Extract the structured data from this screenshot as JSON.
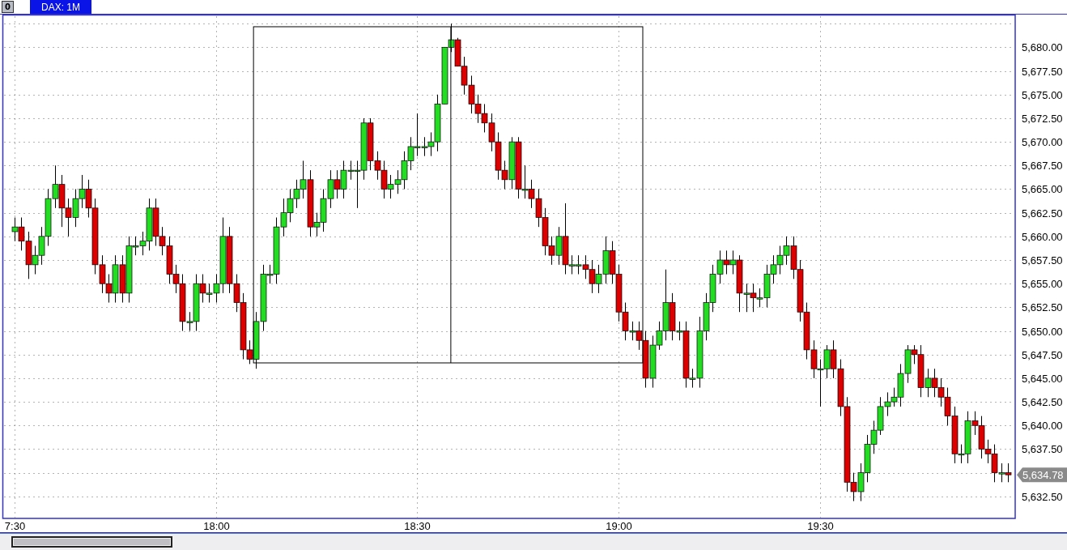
{
  "window": {
    "button": "0"
  },
  "chart": {
    "last_price_label": "5,634.78",
    "chart_data": {
      "type": "candlestick",
      "title": "DAX: 1M",
      "grid": true,
      "ylim": [
        5630.17,
        5683.42
      ],
      "yticks": [
        {
          "value": 5632.5,
          "label": "5,632.50"
        },
        {
          "value": 5637.5,
          "label": "5,637.50"
        },
        {
          "value": 5640,
          "label": "5,640.00"
        },
        {
          "value": 5642.5,
          "label": "5,642.50"
        },
        {
          "value": 5645,
          "label": "5,645.00"
        },
        {
          "value": 5647.5,
          "label": "5,647.50"
        },
        {
          "value": 5650,
          "label": "5,650.00"
        },
        {
          "value": 5652.5,
          "label": "5,652.50"
        },
        {
          "value": 5655,
          "label": "5,655.00"
        },
        {
          "value": 5657.5,
          "label": "5,657.50"
        },
        {
          "value": 5660,
          "label": "5,660.00"
        },
        {
          "value": 5662.5,
          "label": "5,662.50"
        },
        {
          "value": 5665,
          "label": "5,665.00"
        },
        {
          "value": 5667.5,
          "label": "5,667.50"
        },
        {
          "value": 5670,
          "label": "5,670.00"
        },
        {
          "value": 5672.5,
          "label": "5,672.50"
        },
        {
          "value": 5675,
          "label": "5,675.00"
        },
        {
          "value": 5677.5,
          "label": "5,677.50"
        },
        {
          "value": 5680,
          "label": "5,680.00"
        }
      ],
      "categories": [
        "7:30",
        null,
        null,
        null,
        null,
        null,
        null,
        null,
        null,
        null,
        null,
        null,
        null,
        null,
        null,
        null,
        null,
        null,
        null,
        null,
        null,
        null,
        null,
        null,
        null,
        null,
        null,
        null,
        null,
        null,
        "18:00",
        null,
        null,
        null,
        null,
        null,
        null,
        null,
        null,
        null,
        null,
        null,
        null,
        null,
        null,
        null,
        null,
        null,
        null,
        null,
        null,
        null,
        null,
        null,
        null,
        null,
        null,
        null,
        null,
        null,
        "18:30",
        null,
        null,
        null,
        null,
        null,
        null,
        null,
        null,
        null,
        null,
        null,
        null,
        null,
        null,
        null,
        null,
        null,
        null,
        null,
        null,
        null,
        null,
        null,
        null,
        null,
        null,
        null,
        null,
        null,
        "19:00",
        null,
        null,
        null,
        null,
        null,
        null,
        null,
        null,
        null,
        null,
        null,
        null,
        null,
        null,
        null,
        null,
        null,
        null,
        null,
        null,
        null,
        null,
        null,
        null,
        null,
        null,
        null,
        null,
        null,
        "19:30",
        null,
        null,
        null,
        null,
        null,
        null,
        null,
        null,
        null,
        null,
        null,
        null,
        null,
        null,
        null,
        null,
        null,
        null,
        null,
        null,
        null,
        null,
        null,
        null,
        null,
        null,
        null,
        null
      ],
      "ohlc": [
        [
          5660.5,
          5662,
          5659.5,
          5661
        ],
        [
          5661,
          5662,
          5658.5,
          5659.5
        ],
        [
          5659.5,
          5660.5,
          5655.5,
          5657
        ],
        [
          5657,
          5659,
          5656,
          5658
        ],
        [
          5658,
          5661,
          5657,
          5660
        ],
        [
          5660,
          5665,
          5659,
          5664
        ],
        [
          5664,
          5667.5,
          5663,
          5665.5
        ],
        [
          5665.5,
          5666.5,
          5661,
          5663
        ],
        [
          5663,
          5664,
          5660,
          5662
        ],
        [
          5662,
          5665,
          5661,
          5664
        ],
        [
          5664,
          5666.5,
          5663,
          5665
        ],
        [
          5665,
          5666,
          5662,
          5663
        ],
        [
          5663,
          5664,
          5656,
          5657
        ],
        [
          5657,
          5658,
          5654,
          5655
        ],
        [
          5655,
          5656,
          5653,
          5654
        ],
        [
          5654,
          5658,
          5653,
          5657
        ],
        [
          5657,
          5658,
          5653,
          5654
        ],
        [
          5654,
          5660,
          5653,
          5659
        ],
        [
          5659,
          5660,
          5658,
          5659
        ],
        [
          5659,
          5660.5,
          5658,
          5659.5
        ],
        [
          5659.5,
          5664,
          5658.5,
          5663
        ],
        [
          5663,
          5664,
          5659,
          5660
        ],
        [
          5660,
          5661,
          5658,
          5659
        ],
        [
          5659,
          5660,
          5655,
          5656
        ],
        [
          5656,
          5657,
          5654,
          5655
        ],
        [
          5655,
          5656,
          5650,
          5651
        ],
        [
          5651,
          5652,
          5650,
          5651
        ],
        [
          5651,
          5656,
          5650,
          5655
        ],
        [
          5655,
          5656,
          5653,
          5654
        ],
        [
          5654,
          5655,
          5653,
          5654
        ],
        [
          5654,
          5656,
          5653,
          5655
        ],
        [
          5655,
          5662,
          5654,
          5660
        ],
        [
          5660,
          5661,
          5654,
          5655
        ],
        [
          5655,
          5656,
          5652,
          5653
        ],
        [
          5653,
          5654,
          5647,
          5648
        ],
        [
          5648,
          5649,
          5646.5,
          5647
        ],
        [
          5647,
          5652,
          5646,
          5651
        ],
        [
          5651,
          5657,
          5650,
          5656
        ],
        [
          5656,
          5657,
          5655,
          5656
        ],
        [
          5656,
          5662,
          5655,
          5661
        ],
        [
          5661,
          5664,
          5660,
          5662.5
        ],
        [
          5662.5,
          5665,
          5661.5,
          5664
        ],
        [
          5664,
          5666,
          5663,
          5665
        ],
        [
          5665,
          5668,
          5664,
          5666
        ],
        [
          5666,
          5667,
          5660,
          5661
        ],
        [
          5661,
          5662.5,
          5660,
          5661.5
        ],
        [
          5661.5,
          5665,
          5660.5,
          5664
        ],
        [
          5664,
          5667,
          5663,
          5666
        ],
        [
          5666,
          5667,
          5664,
          5665
        ],
        [
          5665,
          5668,
          5664,
          5667
        ],
        [
          5667,
          5668,
          5666,
          5667
        ],
        [
          5667,
          5668,
          5663,
          5667
        ],
        [
          5667,
          5672.5,
          5666,
          5672
        ],
        [
          5672,
          5672.5,
          5667,
          5668
        ],
        [
          5668,
          5669,
          5666,
          5667
        ],
        [
          5667,
          5668,
          5664,
          5665
        ],
        [
          5665,
          5666.5,
          5664,
          5665.5
        ],
        [
          5665.5,
          5667,
          5664.5,
          5666
        ],
        [
          5666,
          5669,
          5665,
          5668
        ],
        [
          5668,
          5670.5,
          5667,
          5669.5
        ],
        [
          5669.5,
          5673,
          5668.5,
          5669.5
        ],
        [
          5669.5,
          5670.5,
          5668.5,
          5669.5
        ],
        [
          5669.5,
          5671,
          5668.5,
          5670
        ],
        [
          5670,
          5675,
          5669,
          5674
        ],
        [
          5674,
          5680,
          5674,
          5680
        ],
        [
          5680,
          5682.5,
          5679.5,
          5680.8
        ],
        [
          5680.8,
          5681,
          5678,
          5678
        ],
        [
          5678,
          5679,
          5675,
          5676
        ],
        [
          5676,
          5677,
          5673,
          5674
        ],
        [
          5674,
          5675,
          5672,
          5673
        ],
        [
          5673,
          5674,
          5671,
          5672
        ],
        [
          5672,
          5673,
          5669,
          5670
        ],
        [
          5670,
          5671,
          5666,
          5667
        ],
        [
          5667,
          5668,
          5665,
          5666
        ],
        [
          5666,
          5670.5,
          5665,
          5670
        ],
        [
          5670,
          5670.5,
          5664,
          5665
        ],
        [
          5665,
          5667.5,
          5664,
          5665
        ],
        [
          5665,
          5666,
          5663,
          5664
        ],
        [
          5664,
          5665,
          5661,
          5662
        ],
        [
          5662,
          5663,
          5658,
          5659
        ],
        [
          5659,
          5660,
          5657,
          5658
        ],
        [
          5658,
          5661,
          5657,
          5660
        ],
        [
          5660,
          5663.5,
          5656,
          5657
        ],
        [
          5657,
          5658,
          5656,
          5657
        ],
        [
          5657,
          5658,
          5656,
          5657
        ],
        [
          5657,
          5658,
          5655.5,
          5656.5
        ],
        [
          5656.5,
          5657.5,
          5654,
          5655
        ],
        [
          5655,
          5657,
          5654,
          5656
        ],
        [
          5656,
          5660,
          5655,
          5658.5
        ],
        [
          5658.5,
          5659.5,
          5655,
          5656
        ],
        [
          5656,
          5657,
          5651,
          5652
        ],
        [
          5652,
          5653,
          5649,
          5650
        ],
        [
          5650,
          5651,
          5649,
          5650
        ],
        [
          5650,
          5651,
          5648,
          5649
        ],
        [
          5649,
          5650,
          5644,
          5645
        ],
        [
          5645,
          5649.5,
          5644,
          5648.5
        ],
        [
          5648.5,
          5651,
          5648,
          5650
        ],
        [
          5650,
          5656.5,
          5649,
          5653
        ],
        [
          5653,
          5654,
          5649,
          5650
        ],
        [
          5650,
          5651,
          5649,
          5650
        ],
        [
          5650,
          5651,
          5644,
          5645
        ],
        [
          5645,
          5646,
          5644,
          5645
        ],
        [
          5645,
          5651.5,
          5644,
          5650
        ],
        [
          5650,
          5654,
          5649,
          5653
        ],
        [
          5653,
          5657,
          5652,
          5656
        ],
        [
          5656,
          5658.5,
          5655,
          5657.5
        ],
        [
          5657.5,
          5658.5,
          5656,
          5657
        ],
        [
          5657,
          5658.5,
          5656,
          5657.5
        ],
        [
          5657.5,
          5658,
          5652,
          5654
        ],
        [
          5654,
          5655,
          5652,
          5654
        ],
        [
          5654,
          5655,
          5652,
          5653.5
        ],
        [
          5653.5,
          5654.5,
          5652.5,
          5653.5
        ],
        [
          5653.5,
          5657,
          5652.5,
          5656
        ],
        [
          5656,
          5658,
          5655,
          5657
        ],
        [
          5657,
          5659,
          5656,
          5658
        ],
        [
          5658,
          5660,
          5657,
          5659
        ],
        [
          5659,
          5660,
          5655.5,
          5656.5
        ],
        [
          5656.5,
          5657.5,
          5651,
          5652
        ],
        [
          5652,
          5653,
          5647,
          5648
        ],
        [
          5648,
          5649,
          5645,
          5646
        ],
        [
          5646,
          5647,
          5642,
          5646
        ],
        [
          5646,
          5648.5,
          5645,
          5648
        ],
        [
          5648,
          5649,
          5645,
          5646
        ],
        [
          5646,
          5647,
          5641,
          5642
        ],
        [
          5642,
          5643,
          5633,
          5634
        ],
        [
          5634,
          5635,
          5632,
          5633
        ],
        [
          5633,
          5636,
          5632,
          5635
        ],
        [
          5635,
          5639,
          5634,
          5638
        ],
        [
          5638,
          5640.5,
          5637,
          5639.5
        ],
        [
          5639.5,
          5643,
          5639,
          5642
        ],
        [
          5642,
          5643.5,
          5641,
          5642.5
        ],
        [
          5642.5,
          5644,
          5642,
          5643
        ],
        [
          5643,
          5646.5,
          5642,
          5645.5
        ],
        [
          5645.5,
          5648.5,
          5644.5,
          5648
        ],
        [
          5648,
          5648.5,
          5646.5,
          5647.5
        ],
        [
          5647.5,
          5648.5,
          5643,
          5644
        ],
        [
          5644,
          5646,
          5643,
          5645
        ],
        [
          5645,
          5646,
          5643,
          5644
        ],
        [
          5644,
          5645,
          5642,
          5643
        ],
        [
          5643,
          5644,
          5640,
          5641
        ],
        [
          5641,
          5642,
          5636,
          5637
        ],
        [
          5637,
          5638,
          5636,
          5637
        ],
        [
          5637,
          5641.5,
          5636,
          5640.5
        ],
        [
          5640.5,
          5641.5,
          5639,
          5640
        ],
        [
          5640,
          5641,
          5636.5,
          5637.5
        ],
        [
          5637.5,
          5638.5,
          5636,
          5637
        ],
        [
          5637,
          5638,
          5634,
          5635
        ],
        [
          5635,
          5636,
          5634,
          5635
        ],
        [
          5635,
          5636,
          5634,
          5634.78
        ]
      ]
    }
  }
}
